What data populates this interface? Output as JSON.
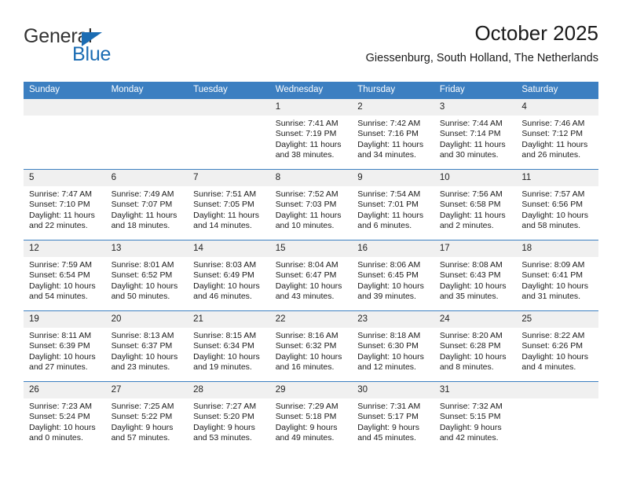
{
  "brand": {
    "name_part1": "General",
    "name_part2": "Blue",
    "accent_color": "#1b6cb3"
  },
  "header": {
    "title": "October 2025",
    "subtitle": "Giessenburg, South Holland, The Netherlands"
  },
  "calendar": {
    "header_color": "#3c7fc1",
    "daynum_band_color": "#f0f0f0",
    "weekdays": [
      "Sunday",
      "Monday",
      "Tuesday",
      "Wednesday",
      "Thursday",
      "Friday",
      "Saturday"
    ],
    "labels": {
      "sunrise": "Sunrise:",
      "sunset": "Sunset:",
      "daylight": "Daylight:"
    },
    "weeks": [
      [
        {
          "day": "",
          "blank": true
        },
        {
          "day": "",
          "blank": true
        },
        {
          "day": "",
          "blank": true
        },
        {
          "day": "1",
          "sunrise": "Sunrise: 7:41 AM",
          "sunset": "Sunset: 7:19 PM",
          "daylight": "Daylight: 11 hours and 38 minutes."
        },
        {
          "day": "2",
          "sunrise": "Sunrise: 7:42 AM",
          "sunset": "Sunset: 7:16 PM",
          "daylight": "Daylight: 11 hours and 34 minutes."
        },
        {
          "day": "3",
          "sunrise": "Sunrise: 7:44 AM",
          "sunset": "Sunset: 7:14 PM",
          "daylight": "Daylight: 11 hours and 30 minutes."
        },
        {
          "day": "4",
          "sunrise": "Sunrise: 7:46 AM",
          "sunset": "Sunset: 7:12 PM",
          "daylight": "Daylight: 11 hours and 26 minutes."
        }
      ],
      [
        {
          "day": "5",
          "sunrise": "Sunrise: 7:47 AM",
          "sunset": "Sunset: 7:10 PM",
          "daylight": "Daylight: 11 hours and 22 minutes."
        },
        {
          "day": "6",
          "sunrise": "Sunrise: 7:49 AM",
          "sunset": "Sunset: 7:07 PM",
          "daylight": "Daylight: 11 hours and 18 minutes."
        },
        {
          "day": "7",
          "sunrise": "Sunrise: 7:51 AM",
          "sunset": "Sunset: 7:05 PM",
          "daylight": "Daylight: 11 hours and 14 minutes."
        },
        {
          "day": "8",
          "sunrise": "Sunrise: 7:52 AM",
          "sunset": "Sunset: 7:03 PM",
          "daylight": "Daylight: 11 hours and 10 minutes."
        },
        {
          "day": "9",
          "sunrise": "Sunrise: 7:54 AM",
          "sunset": "Sunset: 7:01 PM",
          "daylight": "Daylight: 11 hours and 6 minutes."
        },
        {
          "day": "10",
          "sunrise": "Sunrise: 7:56 AM",
          "sunset": "Sunset: 6:58 PM",
          "daylight": "Daylight: 11 hours and 2 minutes."
        },
        {
          "day": "11",
          "sunrise": "Sunrise: 7:57 AM",
          "sunset": "Sunset: 6:56 PM",
          "daylight": "Daylight: 10 hours and 58 minutes."
        }
      ],
      [
        {
          "day": "12",
          "sunrise": "Sunrise: 7:59 AM",
          "sunset": "Sunset: 6:54 PM",
          "daylight": "Daylight: 10 hours and 54 minutes."
        },
        {
          "day": "13",
          "sunrise": "Sunrise: 8:01 AM",
          "sunset": "Sunset: 6:52 PM",
          "daylight": "Daylight: 10 hours and 50 minutes."
        },
        {
          "day": "14",
          "sunrise": "Sunrise: 8:03 AM",
          "sunset": "Sunset: 6:49 PM",
          "daylight": "Daylight: 10 hours and 46 minutes."
        },
        {
          "day": "15",
          "sunrise": "Sunrise: 8:04 AM",
          "sunset": "Sunset: 6:47 PM",
          "daylight": "Daylight: 10 hours and 43 minutes."
        },
        {
          "day": "16",
          "sunrise": "Sunrise: 8:06 AM",
          "sunset": "Sunset: 6:45 PM",
          "daylight": "Daylight: 10 hours and 39 minutes."
        },
        {
          "day": "17",
          "sunrise": "Sunrise: 8:08 AM",
          "sunset": "Sunset: 6:43 PM",
          "daylight": "Daylight: 10 hours and 35 minutes."
        },
        {
          "day": "18",
          "sunrise": "Sunrise: 8:09 AM",
          "sunset": "Sunset: 6:41 PM",
          "daylight": "Daylight: 10 hours and 31 minutes."
        }
      ],
      [
        {
          "day": "19",
          "sunrise": "Sunrise: 8:11 AM",
          "sunset": "Sunset: 6:39 PM",
          "daylight": "Daylight: 10 hours and 27 minutes."
        },
        {
          "day": "20",
          "sunrise": "Sunrise: 8:13 AM",
          "sunset": "Sunset: 6:37 PM",
          "daylight": "Daylight: 10 hours and 23 minutes."
        },
        {
          "day": "21",
          "sunrise": "Sunrise: 8:15 AM",
          "sunset": "Sunset: 6:34 PM",
          "daylight": "Daylight: 10 hours and 19 minutes."
        },
        {
          "day": "22",
          "sunrise": "Sunrise: 8:16 AM",
          "sunset": "Sunset: 6:32 PM",
          "daylight": "Daylight: 10 hours and 16 minutes."
        },
        {
          "day": "23",
          "sunrise": "Sunrise: 8:18 AM",
          "sunset": "Sunset: 6:30 PM",
          "daylight": "Daylight: 10 hours and 12 minutes."
        },
        {
          "day": "24",
          "sunrise": "Sunrise: 8:20 AM",
          "sunset": "Sunset: 6:28 PM",
          "daylight": "Daylight: 10 hours and 8 minutes."
        },
        {
          "day": "25",
          "sunrise": "Sunrise: 8:22 AM",
          "sunset": "Sunset: 6:26 PM",
          "daylight": "Daylight: 10 hours and 4 minutes."
        }
      ],
      [
        {
          "day": "26",
          "sunrise": "Sunrise: 7:23 AM",
          "sunset": "Sunset: 5:24 PM",
          "daylight": "Daylight: 10 hours and 0 minutes."
        },
        {
          "day": "27",
          "sunrise": "Sunrise: 7:25 AM",
          "sunset": "Sunset: 5:22 PM",
          "daylight": "Daylight: 9 hours and 57 minutes."
        },
        {
          "day": "28",
          "sunrise": "Sunrise: 7:27 AM",
          "sunset": "Sunset: 5:20 PM",
          "daylight": "Daylight: 9 hours and 53 minutes."
        },
        {
          "day": "29",
          "sunrise": "Sunrise: 7:29 AM",
          "sunset": "Sunset: 5:18 PM",
          "daylight": "Daylight: 9 hours and 49 minutes."
        },
        {
          "day": "30",
          "sunrise": "Sunrise: 7:31 AM",
          "sunset": "Sunset: 5:17 PM",
          "daylight": "Daylight: 9 hours and 45 minutes."
        },
        {
          "day": "31",
          "sunrise": "Sunrise: 7:32 AM",
          "sunset": "Sunset: 5:15 PM",
          "daylight": "Daylight: 9 hours and 42 minutes."
        },
        {
          "day": "",
          "blank": true
        }
      ]
    ]
  }
}
